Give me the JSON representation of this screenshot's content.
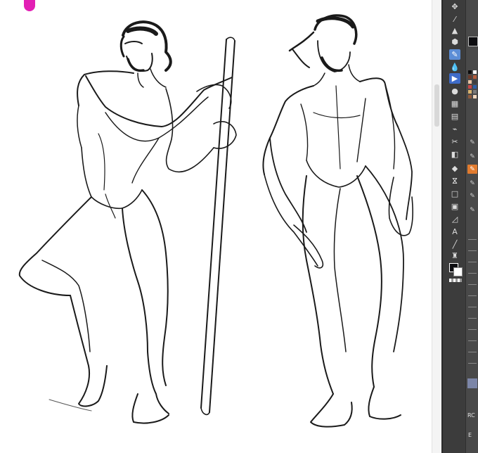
{
  "toolbar": {
    "tools": [
      {
        "name": "move-icon",
        "glyph": "✥"
      },
      {
        "name": "eyedropper-icon",
        "glyph": "⁄"
      },
      {
        "name": "blend-icon",
        "glyph": "▲"
      },
      {
        "name": "eraser-icon",
        "glyph": "⬢"
      },
      {
        "name": "pen-icon",
        "glyph": "✎",
        "active": true
      },
      {
        "name": "water-drop-icon",
        "glyph": "💧"
      },
      {
        "name": "vector-select-icon",
        "glyph": "▶"
      },
      {
        "name": "airbrush-icon",
        "glyph": "●"
      },
      {
        "name": "grid-icon",
        "glyph": "▦"
      },
      {
        "name": "ruler-icon",
        "glyph": "▤"
      },
      {
        "name": "correct-line-icon",
        "glyph": "⌁"
      },
      {
        "name": "scissors-icon",
        "glyph": "✂"
      },
      {
        "name": "gradient-icon",
        "glyph": "◧"
      },
      {
        "name": "fill-icon",
        "glyph": "◆"
      },
      {
        "name": "decoration-icon",
        "glyph": "ⴵ"
      },
      {
        "name": "square-select-icon",
        "glyph": "□"
      },
      {
        "name": "frame-icon",
        "glyph": "▣"
      },
      {
        "name": "figure-icon",
        "glyph": "◿"
      },
      {
        "name": "text-icon",
        "glyph": "A"
      },
      {
        "name": "brush-icon",
        "glyph": "╱"
      },
      {
        "name": "stamp-icon",
        "glyph": "♜"
      }
    ],
    "main_color": "#0d0d10",
    "sub_color": "#ffffff"
  },
  "subtools": {
    "items": [
      {
        "name": "pen-sub-1-icon",
        "glyph": "✎"
      },
      {
        "name": "pen-sub-2-icon",
        "glyph": "✎"
      },
      {
        "name": "pen-sub-3-icon",
        "glyph": "✎",
        "active": true
      },
      {
        "name": "pen-sub-4-icon",
        "glyph": "✎"
      },
      {
        "name": "pen-sub-5-icon",
        "glyph": "✎"
      },
      {
        "name": "pen-sub-6-icon",
        "glyph": "✎"
      }
    ],
    "rc_label": "RC",
    "eb_label": "E"
  },
  "palette_colors": [
    "#0b0b0b",
    "#ffffff",
    "#6b3a2a",
    "#b55d3c",
    "#e8c3a2",
    "#3d3d3d",
    "#c44",
    "#2a5ea8",
    "#d8b36e",
    "#7a7a7a",
    "#8e5a3c",
    "#f0d6bd"
  ]
}
